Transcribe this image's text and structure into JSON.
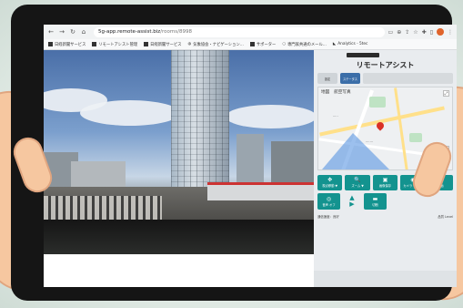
{
  "browser": {
    "url_host": "5g-app.remote-assist.biz",
    "url_path": "/rooms/8998",
    "bookmarks": [
      {
        "label": "日経新聞サービス"
      },
      {
        "label": "リモートアシスト管理"
      },
      {
        "label": "日経新聞サービス"
      },
      {
        "label": "気象協会・ナビゲーション..."
      },
      {
        "label": "サポーター"
      },
      {
        "label": "専門家共通のメール..."
      },
      {
        "label": "Analytics - 5tec"
      }
    ]
  },
  "panel": {
    "title": "リモートアシスト",
    "tab_left": "設定",
    "tab_right": "ステータス",
    "map_tabs": [
      "地図",
      "航空写真"
    ],
    "buttons_row1": [
      {
        "glyph": "✥",
        "label": "視点移動 ▼"
      },
      {
        "glyph": "🔍",
        "label": "ズーム ▼"
      },
      {
        "glyph": "▣",
        "label": "画像保存"
      },
      {
        "glyph": "◉",
        "label": "カメラ 切替 ▼"
      },
      {
        "glyph": "▶",
        "label": "録画"
      }
    ],
    "buttons_row2": [
      {
        "glyph": "◎",
        "label": "音声 オフ"
      },
      {
        "glyph": "▬",
        "label": "切断"
      }
    ],
    "footer_left": "通信速度：良好",
    "footer_right": "品質 Level"
  },
  "colors": {
    "accent": "#13938f",
    "pin": "#d93025"
  }
}
